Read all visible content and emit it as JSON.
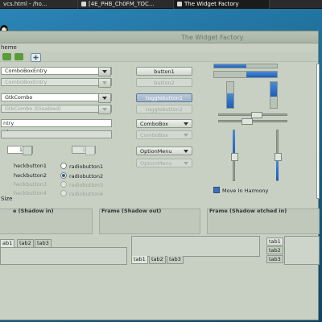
{
  "taskbar": {
    "tasks": [
      "vcs.html - /ho...",
      "[4E_PHB_Ch0FM_TOC...",
      "The Widget Factory"
    ]
  },
  "window": {
    "title": "The Widget Factory",
    "menu_label": "heme"
  },
  "combos": {
    "entry_combo": "ComboBoxEntry",
    "entry_combo_disabled": "ComboBoxEntry",
    "gtk_combo": "GtkCombo",
    "gtk_combo_disabled": "GtkCombo (Disabled)"
  },
  "entries": {
    "entry_text": "ntry",
    "spin_value": "1",
    "spin_value_disabled": "1"
  },
  "checks": {
    "checkbutton1": "heckbutton1",
    "checkbutton2": "heckbutton2",
    "checkbutton3": "heckbutton3",
    "checkbutton4": "heckbutton4",
    "radiobutton1": "radiobutton1",
    "radiobutton2": "radiobutton2",
    "radiobutton3": "radiobutton3",
    "radiobutton4": "radiobutton4"
  },
  "buttons": {
    "button1": "button1",
    "button2": "button2",
    "togglebutton1": "togglebutton1",
    "togglebutton2": "togglebutton2",
    "combobox": "ComboBox",
    "combobox_disabled": "ComboBox",
    "optionmenu": "OptionMenu",
    "optionmenu_disabled": "OptionMenu"
  },
  "misc": {
    "size_label": "Size",
    "move_in_harmony": "Move In Harmony"
  },
  "frames": {
    "shadow_in": "e (Shadow in)",
    "shadow_out": "Frame (Shadow out)",
    "shadow_etched_in": "Frame (Shadow etched in)"
  },
  "notebooks": {
    "nb1_tabs": [
      "ab1",
      "tab2",
      "tab3"
    ],
    "nb2_tabs": [
      "tab1",
      "tab2",
      "tab3"
    ],
    "nb3_tabs": [
      "tab1",
      "tab2",
      "tab3"
    ]
  },
  "colors": {
    "accent_blue": "#1e5db8",
    "window_bg": "#c8d0c4",
    "desktop_blue": "#1d6a94"
  }
}
